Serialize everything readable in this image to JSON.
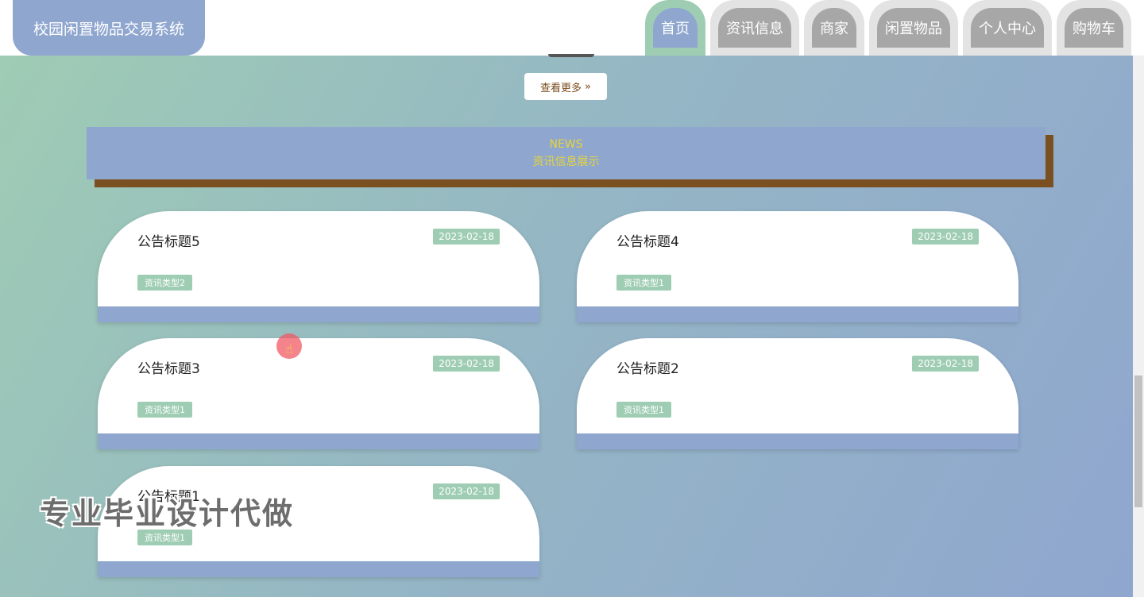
{
  "site": {
    "title": "校园闲置物品交易系统"
  },
  "nav": {
    "items": [
      {
        "label": "首页",
        "active": true
      },
      {
        "label": "资讯信息"
      },
      {
        "label": "商家"
      },
      {
        "label": "闲置物品"
      },
      {
        "label": "个人中心"
      },
      {
        "label": "购物车"
      }
    ]
  },
  "more_button": {
    "label": "查看更多",
    "icon": "double-chevron-right-icon"
  },
  "news_section": {
    "title_en": "NEWS",
    "title_cn": "资讯信息展示"
  },
  "cards": [
    {
      "title": "公告标题5",
      "date": "2023-02-18",
      "type": "资讯类型2"
    },
    {
      "title": "公告标题4",
      "date": "2023-02-18",
      "type": "资讯类型1"
    },
    {
      "title": "公告标题3",
      "date": "2023-02-18",
      "type": "资讯类型1"
    },
    {
      "title": "公告标题2",
      "date": "2023-02-18",
      "type": "资讯类型1"
    },
    {
      "title": "公告标题1",
      "date": "2023-02-18",
      "type": "资讯类型1"
    }
  ],
  "watermark": "专业毕业设计代做",
  "colors": {
    "accent": "#8fa6cf",
    "tag": "#9fcdb3",
    "news_text": "#e6d53a",
    "shadow": "#7b5020"
  }
}
